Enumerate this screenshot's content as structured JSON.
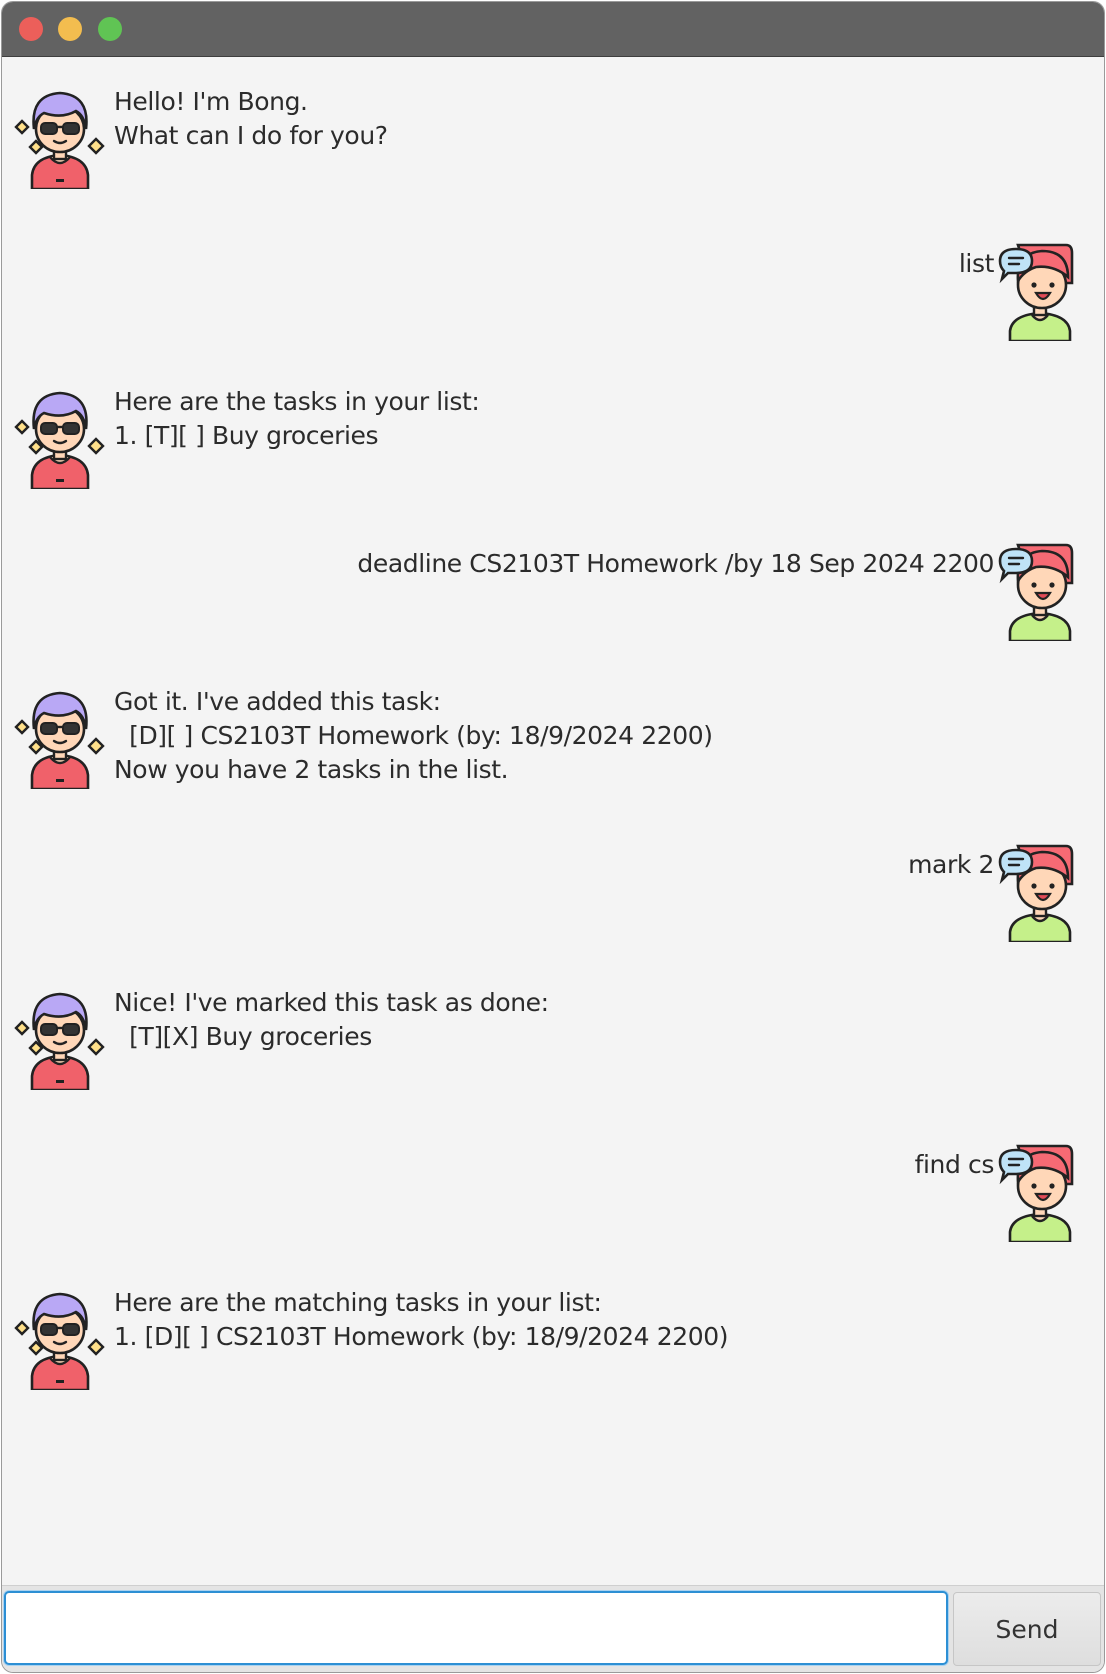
{
  "window": {
    "title_lights": [
      "close",
      "minimize",
      "maximize"
    ]
  },
  "chat": {
    "bong_avatar_icon": "boy-with-sunglasses-avatar-icon",
    "user_avatar_icon": "girl-with-speech-bubble-avatar-icon",
    "messages": [
      {
        "sender": "Bong",
        "text": "Hello! I'm Bong.\nWhat can I do for you?"
      },
      {
        "sender": "User",
        "text": "list"
      },
      {
        "sender": "Bong",
        "text": "Here are the tasks in your list:\n1. [T][ ] Buy groceries"
      },
      {
        "sender": "User",
        "text": "deadline CS2103T Homework /by 18 Sep 2024 2200"
      },
      {
        "sender": "Bong",
        "text": "Got it. I've added this task:\n  [D][ ] CS2103T Homework (by: 18/9/2024 2200)\nNow you have 2 tasks in the list."
      },
      {
        "sender": "User",
        "text": "mark 2"
      },
      {
        "sender": "Bong",
        "text": "Nice! I've marked this task as done:\n  [T][X] Buy groceries"
      },
      {
        "sender": "User",
        "text": "find cs"
      },
      {
        "sender": "Bong",
        "text": "Here are the matching tasks in your list:\n1. [D][ ] CS2103T Homework (by: 18/9/2024 2200)"
      }
    ]
  },
  "input": {
    "value": "",
    "placeholder": "",
    "send_label": "Send"
  },
  "colors": {
    "titlebar": "#626262",
    "chat_background": "#f4f4f4",
    "focus_border": "#2d8fd4"
  }
}
